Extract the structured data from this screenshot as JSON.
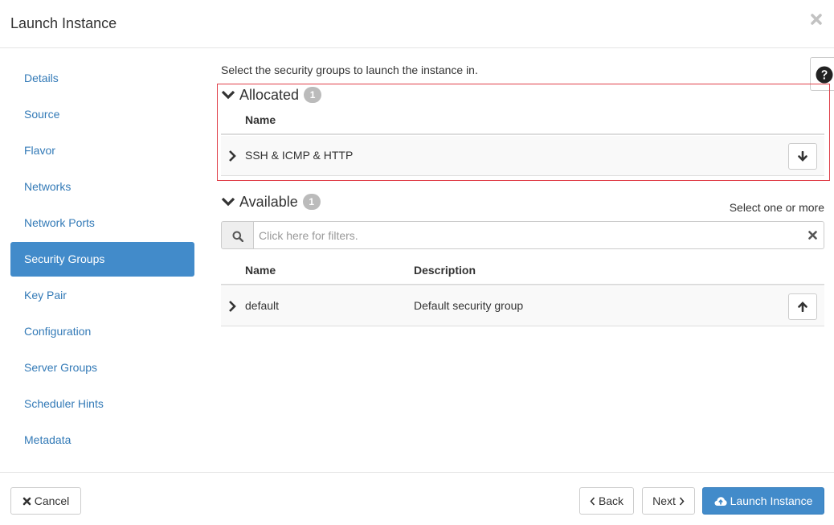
{
  "modal": {
    "title": "Launch Instance"
  },
  "sidebar": {
    "items": [
      {
        "label": "Details"
      },
      {
        "label": "Source"
      },
      {
        "label": "Flavor"
      },
      {
        "label": "Networks"
      },
      {
        "label": "Network Ports"
      },
      {
        "label": "Security Groups",
        "active": true
      },
      {
        "label": "Key Pair"
      },
      {
        "label": "Configuration"
      },
      {
        "label": "Server Groups"
      },
      {
        "label": "Scheduler Hints"
      },
      {
        "label": "Metadata"
      }
    ]
  },
  "main": {
    "intro": "Select the security groups to launch the instance in.",
    "allocated": {
      "title": "Allocated",
      "count": "1",
      "columns": {
        "name": "Name"
      },
      "rows": [
        {
          "name": "SSH & ICMP & HTTP"
        }
      ]
    },
    "available": {
      "title": "Available",
      "count": "1",
      "select_hint": "Select one or more",
      "filter_placeholder": "Click here for filters.",
      "columns": {
        "name": "Name",
        "description": "Description"
      },
      "rows": [
        {
          "name": "default",
          "description": "Default security group"
        }
      ]
    }
  },
  "footer": {
    "cancel_label": "Cancel",
    "back_label": "Back",
    "next_label": "Next",
    "launch_label": "Launch Instance"
  },
  "icons": {
    "close": "close-icon",
    "help": "question-circle-icon",
    "search": "search-icon",
    "arrow_down": "arrow-down-icon",
    "arrow_up": "arrow-up-icon",
    "cloud_upload": "cloud-upload-icon"
  },
  "colors": {
    "primary": "#428bca",
    "link": "#337ab7",
    "highlight_border": "#e0404a",
    "badge": "#bbbbbb"
  }
}
